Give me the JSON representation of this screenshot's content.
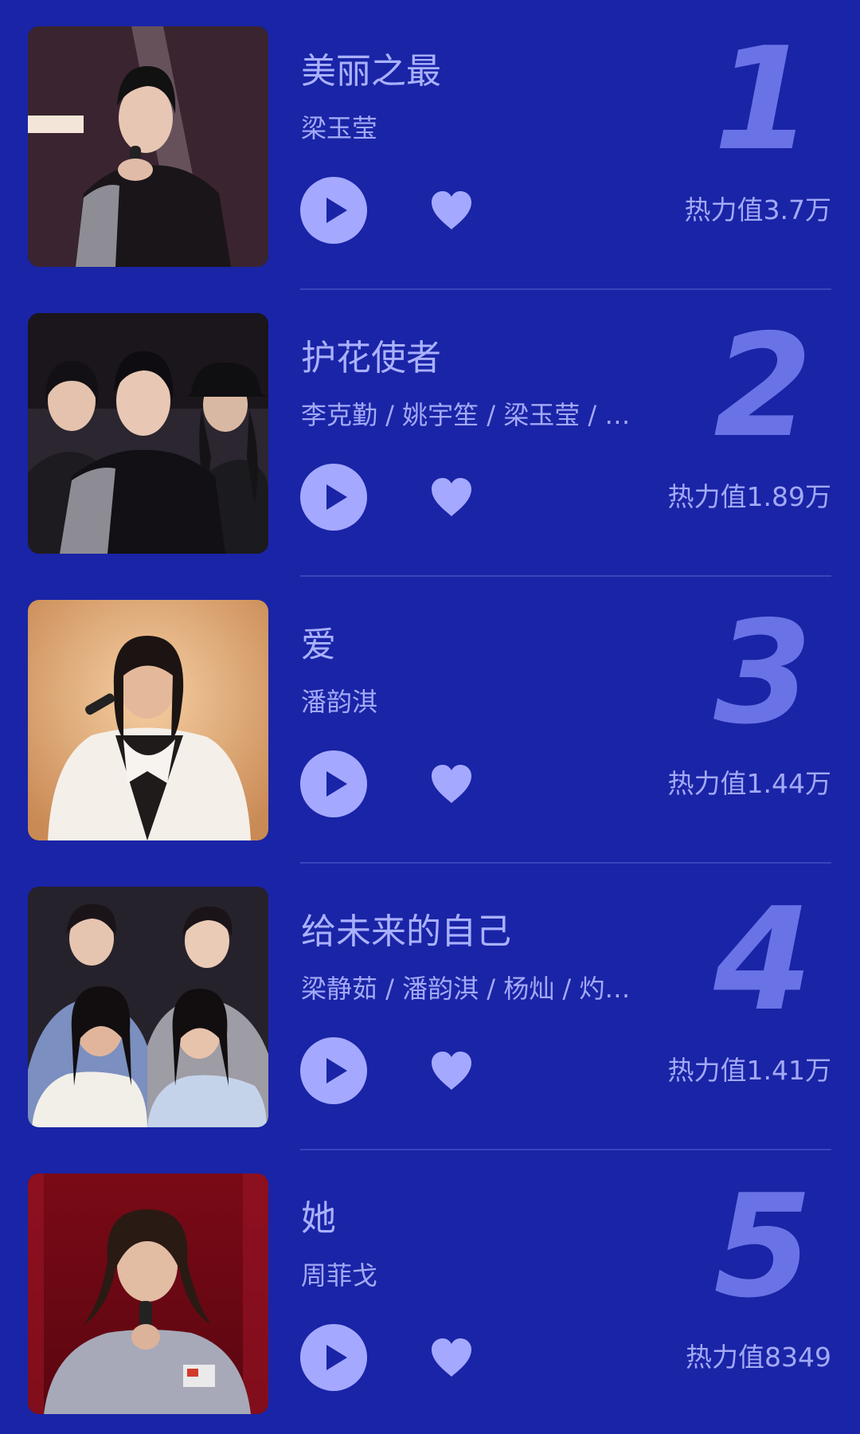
{
  "colors": {
    "background": "#1a24a6",
    "accent": "#a4a9ff",
    "rank_number": "#6a73e6",
    "divider": "#3a44bb"
  },
  "songs": [
    {
      "rank": "1",
      "title": "美丽之最",
      "artists": "梁玉莹",
      "heat": "热力值3.7万",
      "play_icon": "play-icon",
      "like_icon": "heart-icon"
    },
    {
      "rank": "2",
      "title": "护花使者",
      "artists": "李克勤 / 姚宇笙 / 梁玉莹 / …",
      "heat": "热力值1.89万",
      "play_icon": "play-icon",
      "like_icon": "heart-icon"
    },
    {
      "rank": "3",
      "title": "爱",
      "artists": "潘韵淇",
      "heat": "热力值1.44万",
      "play_icon": "play-icon",
      "like_icon": "heart-icon"
    },
    {
      "rank": "4",
      "title": "给未来的自己",
      "artists": "梁静茹 / 潘韵淇 / 杨灿 / 灼…",
      "heat": "热力值1.41万",
      "play_icon": "play-icon",
      "like_icon": "heart-icon"
    },
    {
      "rank": "5",
      "title": "她",
      "artists": "周菲戈",
      "heat": "热力值8349",
      "play_icon": "play-icon",
      "like_icon": "heart-icon"
    }
  ]
}
